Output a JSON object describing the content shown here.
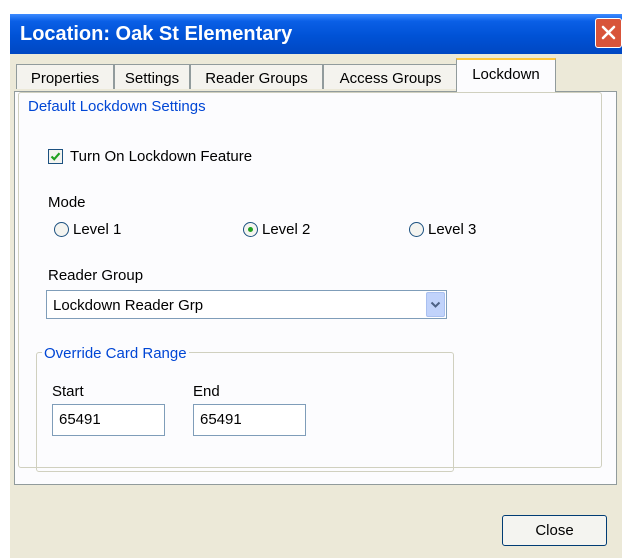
{
  "window": {
    "title": "Location: Oak St Elementary"
  },
  "tabs": [
    {
      "label": "Properties",
      "active": false
    },
    {
      "label": "Settings",
      "active": false
    },
    {
      "label": "Reader Groups",
      "active": false
    },
    {
      "label": "Access Groups",
      "active": false
    },
    {
      "label": "Lockdown",
      "active": true
    }
  ],
  "lockdown": {
    "group_title": "Default Lockdown Settings",
    "feature_checkbox": {
      "label": "Turn On Lockdown Feature",
      "checked": true
    },
    "mode": {
      "label": "Mode",
      "options": [
        {
          "label": "Level 1",
          "selected": false
        },
        {
          "label": "Level 2",
          "selected": true
        },
        {
          "label": "Level 3",
          "selected": false
        }
      ]
    },
    "reader_group": {
      "label": "Reader Group",
      "selected": "Lockdown Reader Grp"
    },
    "override": {
      "title": "Override Card Range",
      "start_label": "Start",
      "start_value": "65491",
      "end_label": "End",
      "end_value": "65491"
    }
  },
  "buttons": {
    "close_label": "Close"
  },
  "colors": {
    "titlebar": "#0054e3",
    "group_title": "#0046d5",
    "active_tab_highlight": "#ffc83c",
    "check_mark": "#21a121"
  }
}
